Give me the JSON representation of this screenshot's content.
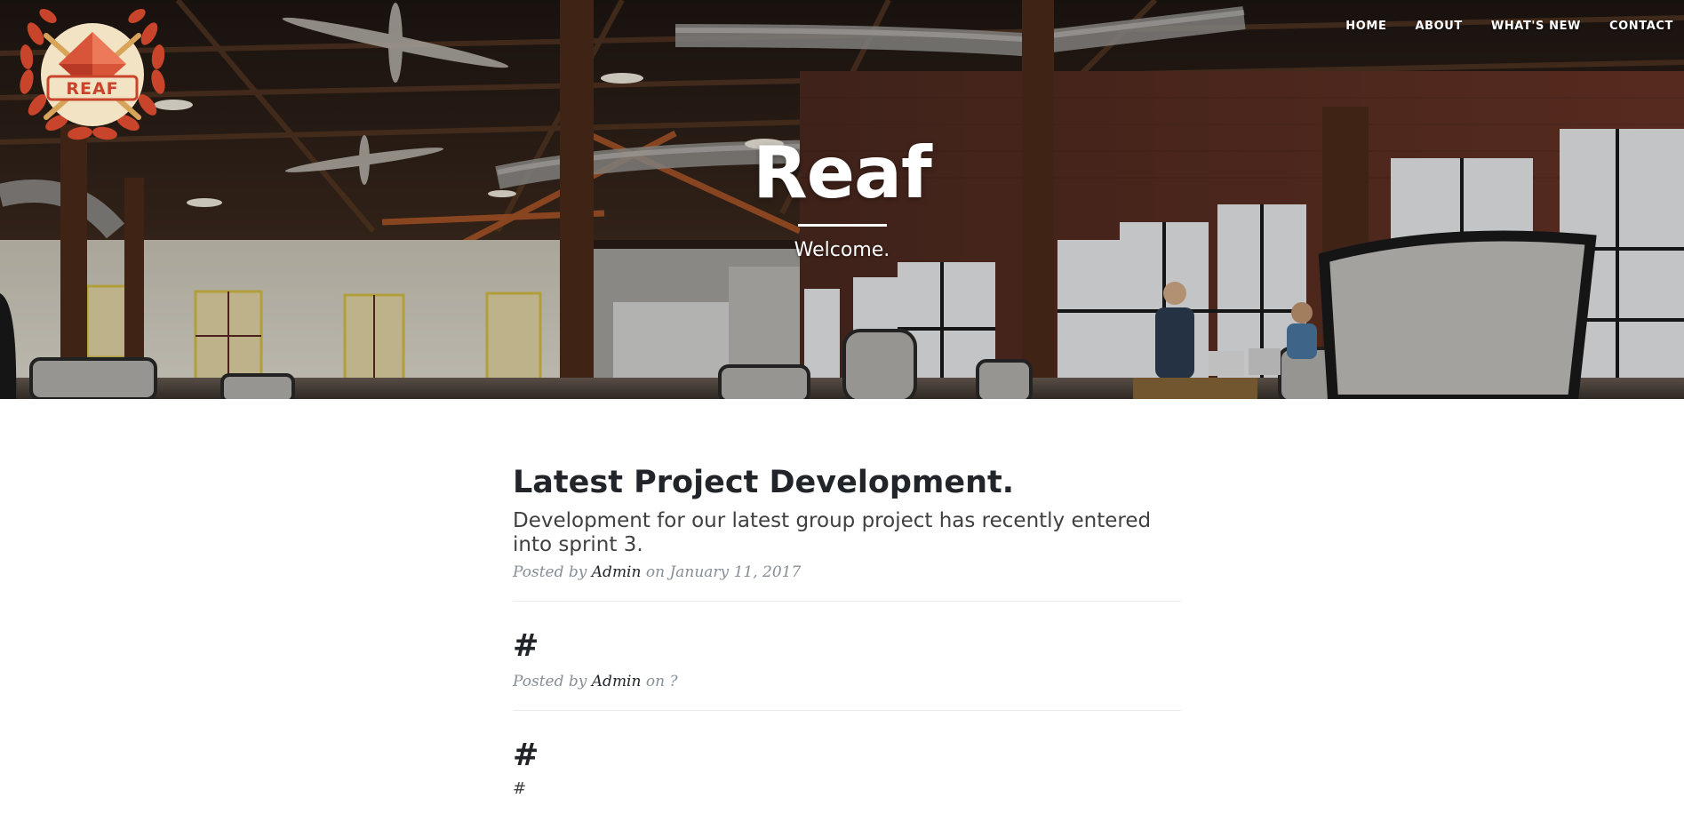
{
  "nav": {
    "home": "HOME",
    "about": "ABOUT",
    "whats_new": "WHAT'S NEW",
    "contact": "CONTACT"
  },
  "logo": {
    "text": "REAF"
  },
  "header": {
    "title": "Reaf",
    "subtitle": "Welcome."
  },
  "posts": [
    {
      "title": "Latest Project Development.",
      "subtitle": "Development for our latest group project has recently entered into sprint 3.",
      "meta_prefix": "Posted by",
      "author": "Admin",
      "meta_on": "on January 11, 2017"
    },
    {
      "title": "#",
      "meta_prefix": "Posted by",
      "author": "Admin",
      "meta_on": "on ?"
    },
    {
      "title": "#",
      "partial": "#"
    }
  ],
  "colors": {
    "heading": "#212529",
    "meta": "#868e96",
    "logo_red": "#c8442b",
    "logo_cream": "#f2e3c4"
  }
}
